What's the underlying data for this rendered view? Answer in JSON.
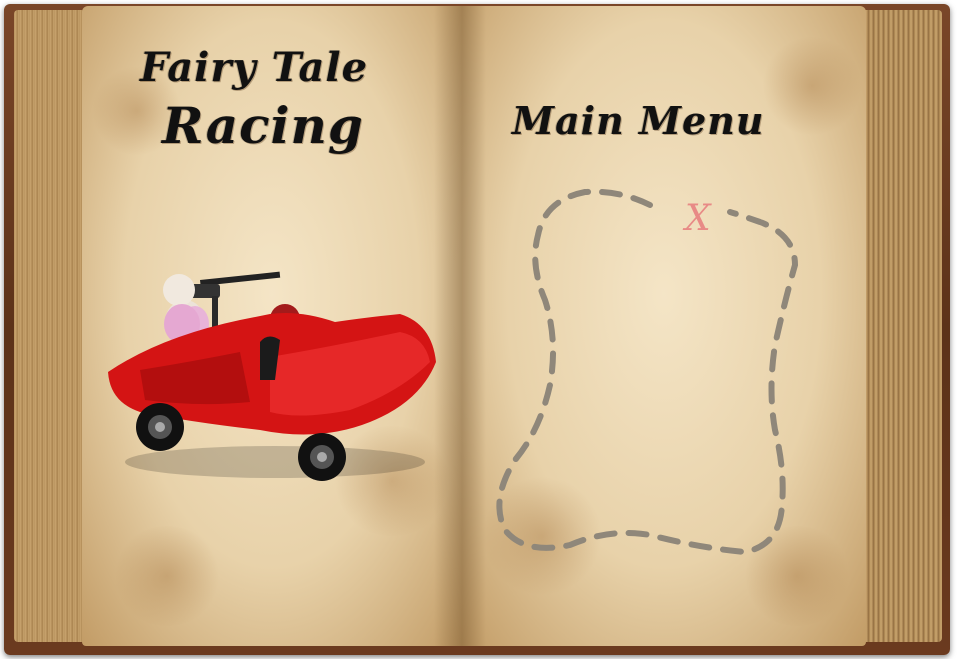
{
  "book": {
    "left_page": {
      "title_line_1": "Fairy Tale",
      "title_line_2": "Racing"
    },
    "right_page": {
      "heading": "Main Menu",
      "map_marker": "X"
    }
  },
  "colors": {
    "cover": "#5c3219",
    "paper": "#e6cfa2",
    "ink": "#111111",
    "path": "#8f877a",
    "marker": "#e88a86",
    "car": "#d41414"
  },
  "icons": [
    "treasure-map-path",
    "x-marker-icon",
    "race-car-illustration"
  ]
}
